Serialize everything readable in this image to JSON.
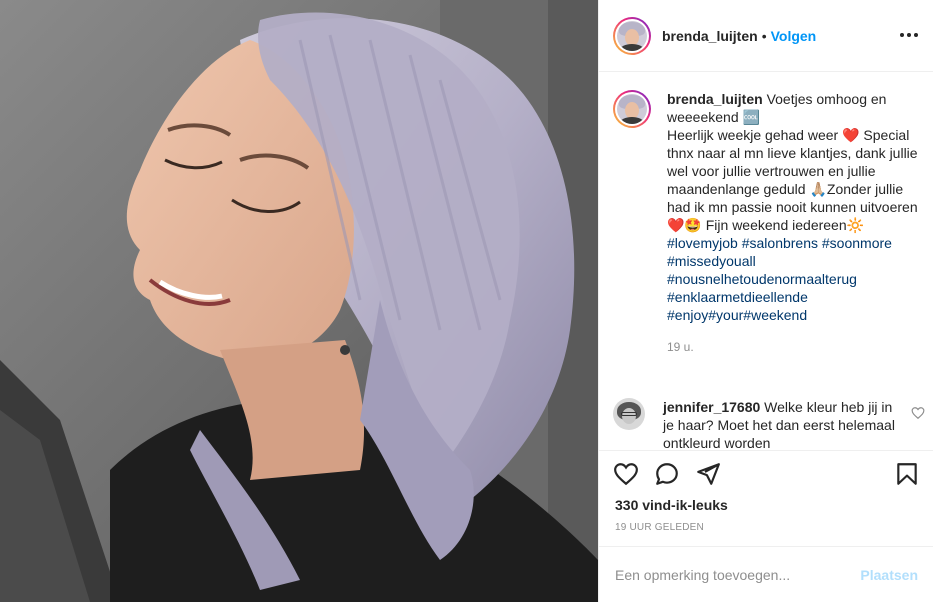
{
  "post": {
    "username": "brenda_luijten",
    "separator": "•",
    "follow_label": "Volgen",
    "more_icon": "more-horizontal-icon",
    "photo_description_colors": {
      "hair": "#b9b4c9",
      "skin": "#e8bda3",
      "background": "#6f6f6f",
      "top": "#1f1f1f"
    }
  },
  "caption": {
    "username": "brenda_luijten",
    "line1": " Voetjes omhoog en weeeekend 🆒",
    "line2": "Heerlijk weekje gehad weer ❤️ Special thnx naar al mn lieve klantjes, dank jullie wel voor jullie vertrouwen en jullie maandenlange geduld 🙏🏼Zonder jullie had ik mn passie nooit kunnen uitvoeren ❤️🤩 Fijn weekend iedereen🔆",
    "hashtags": [
      "#lovemyjob",
      "#salonbrens",
      "#soonmore",
      "#missedyouall",
      "#nousnelhetoudenormaalterug",
      "#enklaarmetdieellende",
      "#enjoy",
      "#your",
      "#weekend"
    ],
    "time": "19 u."
  },
  "comment": {
    "username": "jennifer_17680",
    "text": " Welke kleur heb jij in je haar? Moet het dan eerst helemaal ontkleurd worden"
  },
  "actions": {
    "like_icon": "heart-icon",
    "comment_icon": "comment-icon",
    "share_icon": "send-icon",
    "save_icon": "bookmark-icon",
    "likes_text": "330 vind-ik-leuks",
    "time_ago": "19 UUR GELEDEN"
  },
  "add_comment": {
    "placeholder": "Een opmerking toevoegen...",
    "post_label": "Plaatsen"
  }
}
